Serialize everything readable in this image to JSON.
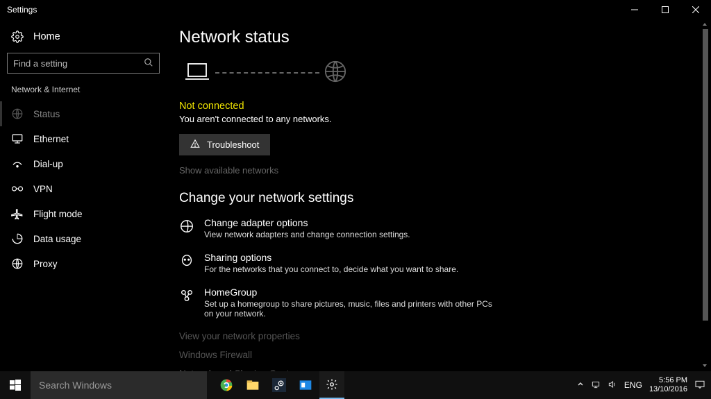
{
  "window": {
    "title": "Settings"
  },
  "sidebar": {
    "home": "Home",
    "search_placeholder": "Find a setting",
    "section": "Network & Internet",
    "items": [
      {
        "label": "Status"
      },
      {
        "label": "Ethernet"
      },
      {
        "label": "Dial-up"
      },
      {
        "label": "VPN"
      },
      {
        "label": "Flight mode"
      },
      {
        "label": "Data usage"
      },
      {
        "label": "Proxy"
      }
    ]
  },
  "main": {
    "heading": "Network status",
    "status_head": "Not connected",
    "status_sub": "You aren't connected to any networks.",
    "troubleshoot": "Troubleshoot",
    "show_available": "Show available networks",
    "change_heading": "Change your network settings",
    "rows": [
      {
        "label": "Change adapter options",
        "desc": "View network adapters and change connection settings."
      },
      {
        "label": "Sharing options",
        "desc": "For the networks that you connect to, decide what you want to share."
      },
      {
        "label": "HomeGroup",
        "desc": "Set up a homegroup to share pictures, music, files and printers with other PCs on your network."
      }
    ],
    "extra_links": [
      "View your network properties",
      "Windows Firewall",
      "Network and Sharing Centre"
    ]
  },
  "taskbar": {
    "search_placeholder": "Search Windows",
    "lang": "ENG",
    "time": "5:56 PM",
    "date": "13/10/2016"
  }
}
